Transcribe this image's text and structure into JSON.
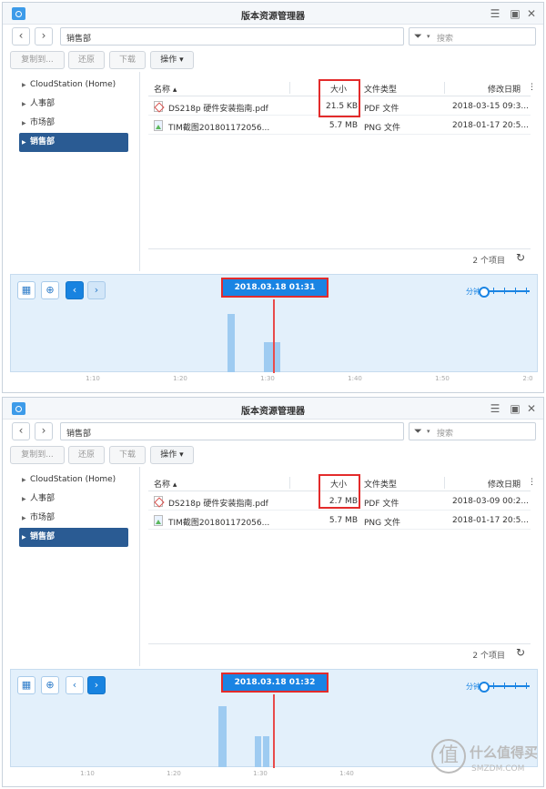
{
  "panels": [
    {
      "title": "版本资源管理器",
      "path": "销售部",
      "search_placeholder": "搜索",
      "toolbar": [
        "复制到...",
        "还原",
        "下载",
        "操作 ▾"
      ],
      "sidebar": [
        "CloudStation (Home)",
        "人事部",
        "市场部",
        "销售部"
      ],
      "columns": {
        "name": "名称 ▴",
        "size": "大小",
        "type": "文件类型",
        "modified": "修改日期"
      },
      "files": [
        {
          "name": "DS218p 硬件安装指南.pdf",
          "size": "21.5 KB",
          "type": "PDF 文件",
          "modified": "2018-03-15 09:3..."
        },
        {
          "name": "TIM截图201801172056...",
          "size": "5.7 MB",
          "type": "PNG 文件",
          "modified": "2018-01-17 20:5..."
        }
      ],
      "item_count": "2 个项目",
      "timeline_date": "2018.03.18 01:31",
      "zoom_label": "分钟",
      "ticks": [
        "1:10",
        "1:20",
        "1:30",
        "1:40",
        "1:50",
        "2:0"
      ]
    },
    {
      "title": "版本资源管理器",
      "path": "销售部",
      "search_placeholder": "搜索",
      "toolbar": [
        "复制到...",
        "还原",
        "下载",
        "操作 ▾"
      ],
      "sidebar": [
        "CloudStation (Home)",
        "人事部",
        "市场部",
        "销售部"
      ],
      "columns": {
        "name": "名称 ▴",
        "size": "大小",
        "type": "文件类型",
        "modified": "修改日期"
      },
      "files": [
        {
          "name": "DS218p 硬件安装指南.pdf",
          "size": "2.7 MB",
          "type": "PDF 文件",
          "modified": "2018-03-09 00:2..."
        },
        {
          "name": "TIM截图201801172056...",
          "size": "5.7 MB",
          "type": "PNG 文件",
          "modified": "2018-01-17 20:5..."
        }
      ],
      "item_count": "2 个项目",
      "timeline_date": "2018.03.18 01:32",
      "zoom_label": "分钟",
      "ticks": [
        "1:10",
        "1:20",
        "1:30",
        "1:40"
      ]
    }
  ],
  "icons": {
    "back": "chevron-left-icon",
    "forward": "chevron-right-icon",
    "filter": "filter-icon",
    "refresh": "refresh-icon",
    "calendar": "calendar-icon",
    "locate": "crosshair-icon"
  },
  "watermark": {
    "name": "什么值得买",
    "url": "SMZDM.COM",
    "glyph": "值"
  }
}
